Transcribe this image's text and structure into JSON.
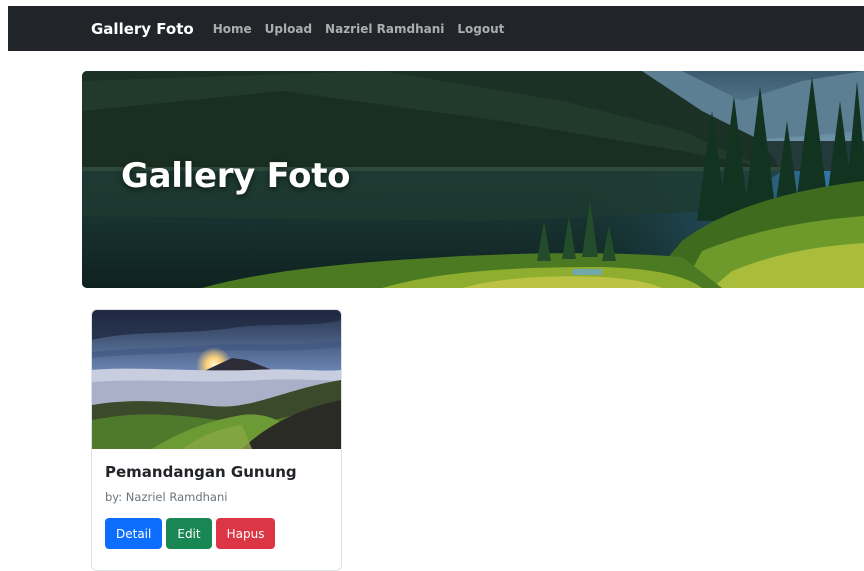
{
  "navbar": {
    "brand": "Gallery Foto",
    "links": [
      "Home",
      "Upload",
      "Nazriel Ramdhani",
      "Logout"
    ]
  },
  "hero": {
    "title": "Gallery Foto",
    "image": "mountain-lake-forest-banner"
  },
  "cards": [
    {
      "title": "Pemandangan Gunung",
      "author": "by: Nazriel Ramdhani",
      "image": "mountain-sunrise-photo",
      "buttons": {
        "detail": "Detail",
        "edit": "Edit",
        "hapus": "Hapus"
      }
    }
  ],
  "colors": {
    "navbar_bg": "#212529",
    "primary": "#0d6efd",
    "success": "#198754",
    "danger": "#dc3545"
  }
}
